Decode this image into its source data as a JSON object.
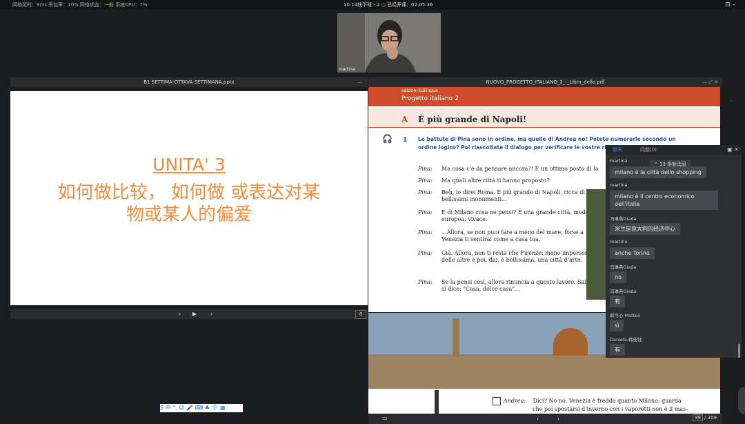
{
  "topbar": {
    "net_prefix": "网络延时：9ms 丢包率：10% 网络状态：",
    "net_state": "一般",
    "cpu": " 系统CPU：7%",
    "class_name": "10.14线下班 - 2",
    "clock_icon": "clock-icon",
    "elapsed": "已经开课：02:05:36",
    "exit_label": "⊡ –"
  },
  "video": {
    "name": "martina"
  },
  "ppt": {
    "title": "B1 SETTIMA-OTTAVA SETTIMANA.pptx",
    "min": "—",
    "slide_title": "UNITA' 3",
    "slide_sub1": "如何做比较， 如何做 或表达对某",
    "slide_sub2": "物或某人的偏爱",
    "prev": "‹",
    "play": "▶",
    "next": "›",
    "page": "8"
  },
  "ime": {
    "label": "S 中 °, ☺ 🎤 ⌨ ♣ 👕 ▦"
  },
  "pdf": {
    "title": "NUOVO_PROGETTO_ITALIANO_2_-_Libro_dello.pdf",
    "controls": "—  ⤢  ✕",
    "publisher": "edizioni Edilingua",
    "project": "Progetto italiano 2",
    "section_letter": "A",
    "heading": "È più grande di Napoli!",
    "ex_num": "1",
    "ex_text": "Le battute di Pina sono in ordine, ma quelle di Andrea no! Potete numerarle secondo un ordine logico? Poi riascoltate il dialogo per verificare le vostre risp",
    "dialogue": [
      {
        "speaker": "Pina:",
        "text": "Ma cosa c'è da pensare ancora?! È un ottimo posto di la"
      },
      {
        "speaker": "Pina:",
        "text": "Ma quali altre città ti hanno proposto?"
      },
      {
        "speaker": "Pina:",
        "text": "Beh, io direi Roma. È più grande di Napoli, ricca di bellissimi monumenti..."
      },
      {
        "speaker": "Pina:",
        "text": "E di Milano cosa ne pensi? È una grande città, moderna, europea, vivace."
      },
      {
        "speaker": "Pina:",
        "text": "...Allora, se non puoi fare a meno del mare, forse a Venezia ti sentirai come a casa tua."
      },
      {
        "speaker": "Pina:",
        "text": "Già. Allora, non ti resta che Firenze: meno impersonale delle altre e poi, dai, è bellissima, una città d'arte."
      },
      {
        "speaker": "Pina:",
        "text": "Se la pensi così, allora rinuncia a questo lavoro. Sai come si dice: \"Casa, dolce casa\"..."
      }
    ],
    "andrea_speaker": "Andrea:",
    "andrea_text1": "Dici? No no, Venezia è fredda quanto Milano: guarda",
    "andrea_text2": "che poi spostarsi d'inverno con i vaporetti non è il mas-",
    "page_cur": "39",
    "page_total": "/ 209",
    "prev": "‹",
    "next": "›"
  },
  "chat": {
    "tab_chat": "聊天",
    "tab_questions": "问题(0)",
    "new_msgs": "⌃ 13 条新消息",
    "messages": [
      {
        "name": "martina",
        "text": "milano è la città dello shopping"
      },
      {
        "name": "martina",
        "text": "milano è il centro economico dell'italia"
      },
      {
        "name": "冯琳燕Giada",
        "text": "米兰是意大利的经济中心"
      },
      {
        "name": "martina",
        "text": "anche Torino"
      },
      {
        "name": "冯琳燕Giada",
        "text": "no"
      },
      {
        "name": "冯琳燕Giada",
        "text": "有"
      },
      {
        "name": "郭可心 Matteo",
        "text": "sì"
      },
      {
        "name": "Daniela-韩佳钰",
        "text": "有"
      }
    ]
  }
}
